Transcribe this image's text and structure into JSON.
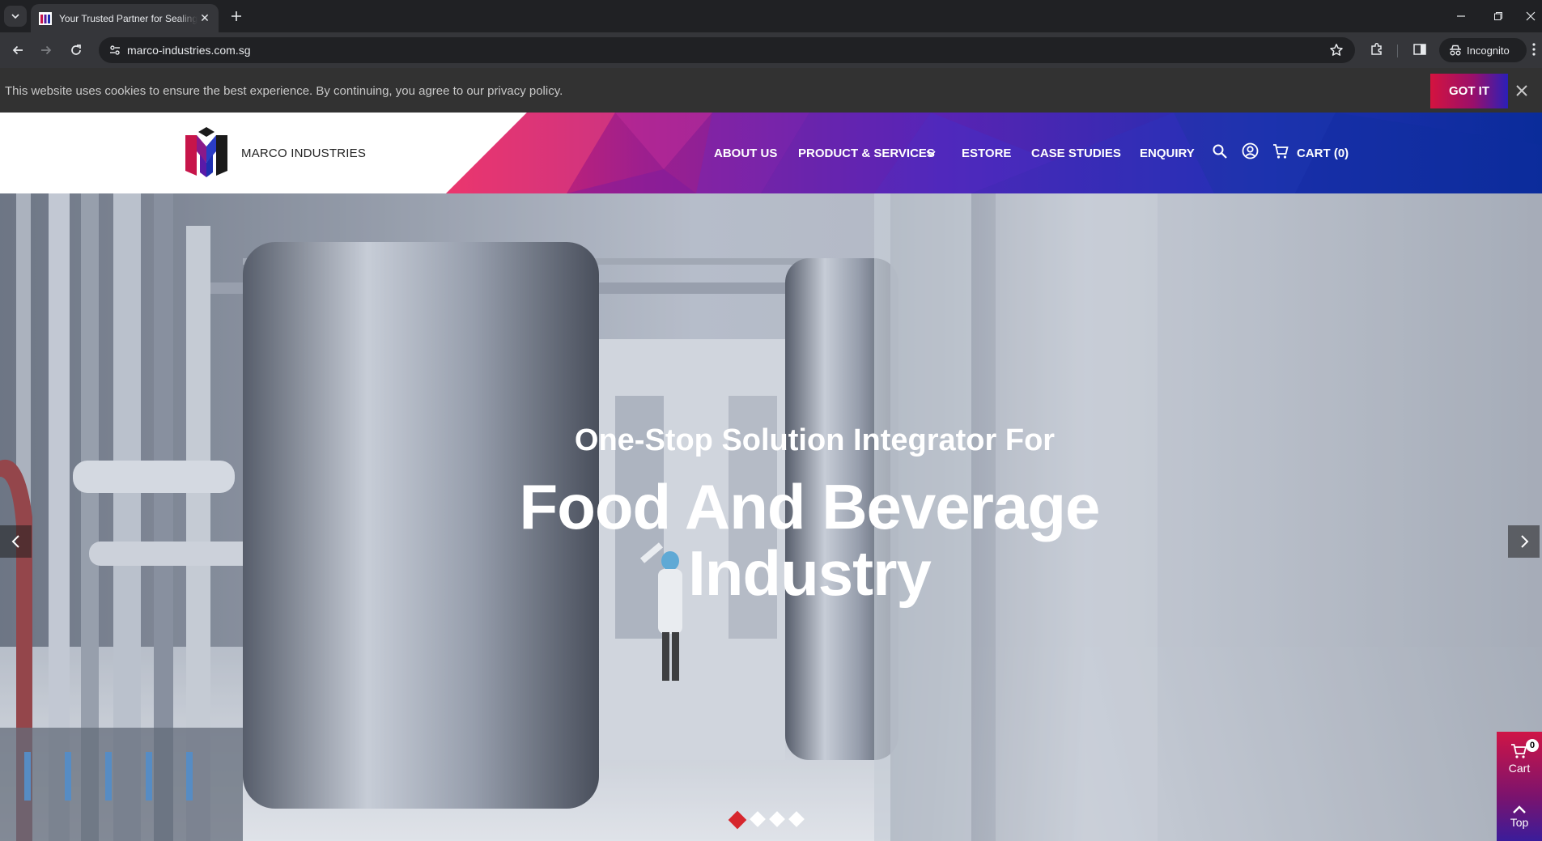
{
  "browser": {
    "tab_title": "Your Trusted Partner for Sealing",
    "url": "marco-industries.com.sg",
    "incognito_label": "Incognito"
  },
  "cookie_bar": {
    "message": "This website uses cookies to ensure the best experience. By continuing, you agree to our privacy policy.",
    "accept_label": "GOT IT"
  },
  "header": {
    "logo_text": "MARCO INDUSTRIES",
    "nav": [
      {
        "label": "ABOUT US"
      },
      {
        "label": "PRODUCT & SERVICES"
      },
      {
        "label": "ESTORE"
      },
      {
        "label": "CASE STUDIES"
      },
      {
        "label": "ENQUIRY"
      }
    ],
    "cart_label": "CART (0)"
  },
  "hero": {
    "subtitle": "One-Stop Solution Integrator For",
    "title_line1": "Food And Beverage",
    "title_line2": "Industry",
    "slide_count": 4,
    "active_slide": 1
  },
  "floating": {
    "cart_label": "Cart",
    "cart_count": "0",
    "top_label": "Top"
  },
  "colors": {
    "accent_red": "#d6262d",
    "brand_gradient_start": "#d4133f",
    "brand_gradient_end": "#2b1fb8",
    "header_blue": "#0b2a9e",
    "cookie_bg": "#323232"
  },
  "icons": [
    "tab-search-icon",
    "close-icon",
    "plus-icon",
    "back-icon",
    "forward-icon",
    "reload-icon",
    "site-info-icon",
    "star-icon",
    "extensions-icon",
    "sidepanel-icon",
    "incognito-icon",
    "more-icon",
    "search-icon",
    "account-icon",
    "cart-icon",
    "chevron-down-icon",
    "chevron-left-icon",
    "chevron-right-icon",
    "arrow-up-icon"
  ]
}
